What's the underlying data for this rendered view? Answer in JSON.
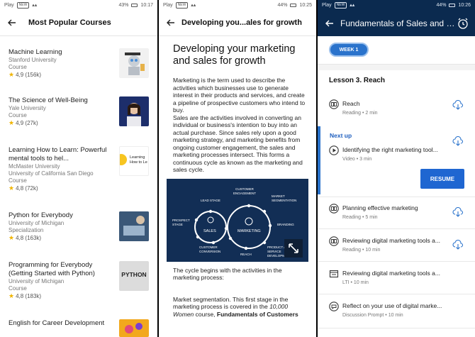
{
  "screen1": {
    "status": {
      "left": "Play",
      "chip": "NEW",
      "battery": "43%",
      "time": "10:17"
    },
    "title": "Most Popular Courses",
    "courses": [
      {
        "name": "Machine Learning",
        "org": "Stanford University",
        "type": "Course",
        "rating": "4,9 (156k)"
      },
      {
        "name": "The Science of Well-Being",
        "org": "Yale University",
        "type": "Course",
        "rating": "4,9 (27k)"
      },
      {
        "name": "Learning How to Learn: Powerful mental tools to hel...",
        "org": "McMaster University",
        "org2": "University of California San Diego",
        "type": "Course",
        "rating": "4,8 (72k)",
        "thumb_text": "Learning How to Le"
      },
      {
        "name": "Python for Everybody",
        "org": "University of Michigan",
        "type": "Specialization",
        "rating": "4,8 (163k)"
      },
      {
        "name": "Programming for Everybody (Getting Started with Python)",
        "org": "University of Michigan",
        "type": "Course",
        "rating": "4,8 (183k)",
        "thumb_text": "PYTHON"
      },
      {
        "name": "English for Career Development"
      }
    ]
  },
  "screen2": {
    "status": {
      "left": "Play",
      "chip": "NEW",
      "battery": "44%",
      "time": "10:25"
    },
    "title": "Developing you...ales for growth",
    "heading": "Developing your marketing and sales for growth",
    "para1": "Marketing is the term used to describe the activities which businesses use to generate interest in their products and services, and create a pipeline of prospective customers who intend to buy.",
    "para2": "Sales are the activities involved in converting an individual or business's intention to buy into an actual purchase. Since sales rely upon a good marketing strategy, and marketing benefits from ongoing customer engagement, the sales and marketing processes intersect. This forms a continuous cycle as known as the marketing and sales cycle.",
    "diagram": {
      "sales": "SALES",
      "marketing": "MARKETING",
      "labels": [
        "LEAD STAGE",
        "CUSTOMER ENGAGEMENT",
        "MARKET SEGMENTATION",
        "PROSPECT STAGE",
        "BRANDING",
        "CUSTOMER CONVERSION",
        "REACH",
        "PRODUCT / SERVICE DEVELOPMENT"
      ]
    },
    "para3": "The cycle begins with the activities in the marketing process:",
    "para4a": "Market segmentation. This first stage in the marketing process is covered in the ",
    "para4b": "10,000 Women",
    "para4c": " course, ",
    "para4d": "Fundamentals of Customers"
  },
  "screen3": {
    "status": {
      "left": "Play",
      "chip": "NEW",
      "battery": "44%",
      "time": "10:26"
    },
    "title": "Fundamentals of Sales and Mar...",
    "week": "WEEK 1",
    "lesson": "Lesson 3. Reach",
    "next_up": "Next up",
    "resume": "RESUME",
    "items": [
      {
        "name": "Reach",
        "meta": "Reading • 2 min"
      },
      {
        "name": "Identifying the right marketing tool...",
        "meta": "Video • 3 min"
      },
      {
        "name": "Planning effective marketing",
        "meta": "Reading • 5 min"
      },
      {
        "name": "Reviewing digital marketing tools a...",
        "meta": "Reading • 10 min"
      },
      {
        "name": "Reviewing digital marketing tools a...",
        "meta": "LTI • 10 min"
      },
      {
        "name": "Reflect on your use of digital marke...",
        "meta": "Discussion Prompt • 10 min"
      }
    ]
  }
}
